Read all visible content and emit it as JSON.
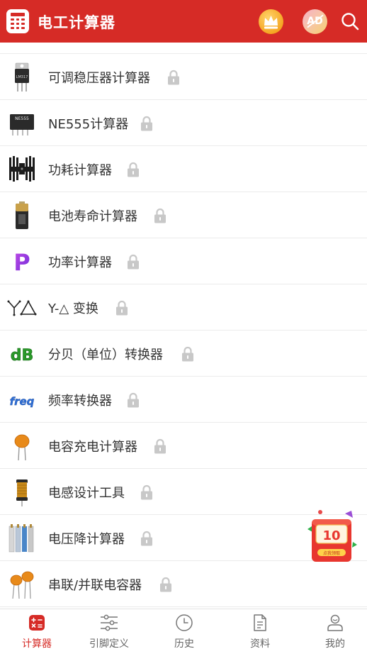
{
  "app": {
    "title": "电工计算器"
  },
  "header": {
    "ad_text": "AD"
  },
  "items": [
    {
      "label": "可调稳压器计算器",
      "icon": "voltage-regulator-icon",
      "thumb_text": "LM317"
    },
    {
      "label": "NE555计算器",
      "icon": "ic-chip-icon",
      "thumb_text": "NE555"
    },
    {
      "label": "功耗计算器",
      "icon": "heatsink-icon"
    },
    {
      "label": "电池寿命计算器",
      "icon": "battery-icon"
    },
    {
      "label": "功率计算器",
      "icon": "power-p-icon",
      "thumb_text": "P"
    },
    {
      "label": "Y-△ 变换",
      "icon": "wye-delta-icon"
    },
    {
      "label": "分贝（单位）转换器",
      "icon": "decibel-icon",
      "thumb_text": "dB"
    },
    {
      "label": "频率转换器",
      "icon": "frequency-icon",
      "thumb_text": "freq"
    },
    {
      "label": "电容充电计算器",
      "icon": "capacitor-icon"
    },
    {
      "label": "电感设计工具",
      "icon": "inductor-icon"
    },
    {
      "label": "电压降计算器",
      "icon": "wire-cable-icon"
    },
    {
      "label": "串联/并联电容器",
      "icon": "capacitors-pair-icon"
    }
  ],
  "promo": {
    "number": "10",
    "button": "点我领取"
  },
  "nav": [
    {
      "label": "计算器",
      "icon": "calculator-icon"
    },
    {
      "label": "引脚定义",
      "icon": "sliders-icon"
    },
    {
      "label": "历史",
      "icon": "clock-icon"
    },
    {
      "label": "资料",
      "icon": "document-icon"
    },
    {
      "label": "我的",
      "icon": "user-icon"
    }
  ],
  "colors": {
    "primary": "#d62b26",
    "text": "#333333",
    "divider": "#ebebeb",
    "lock": "#c8c8c8"
  }
}
